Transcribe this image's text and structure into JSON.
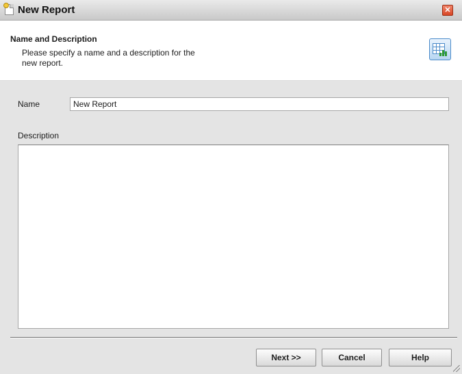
{
  "window": {
    "title": "New Report",
    "close_icon": "close-icon"
  },
  "header": {
    "title": "Name and Description",
    "description": "Please specify a name and a description for the new report.",
    "icon": "report-chart-icon"
  },
  "form": {
    "name_label": "Name",
    "name_value": "New Report",
    "description_label": "Description",
    "description_value": ""
  },
  "buttons": {
    "next": "Next >>",
    "cancel": "Cancel",
    "help": "Help"
  },
  "colors": {
    "dialog_background": "#e4e4e4",
    "close_button": "#d84626",
    "icon_accent": "#4a8ac9",
    "icon_bars": "#2f9a35"
  }
}
